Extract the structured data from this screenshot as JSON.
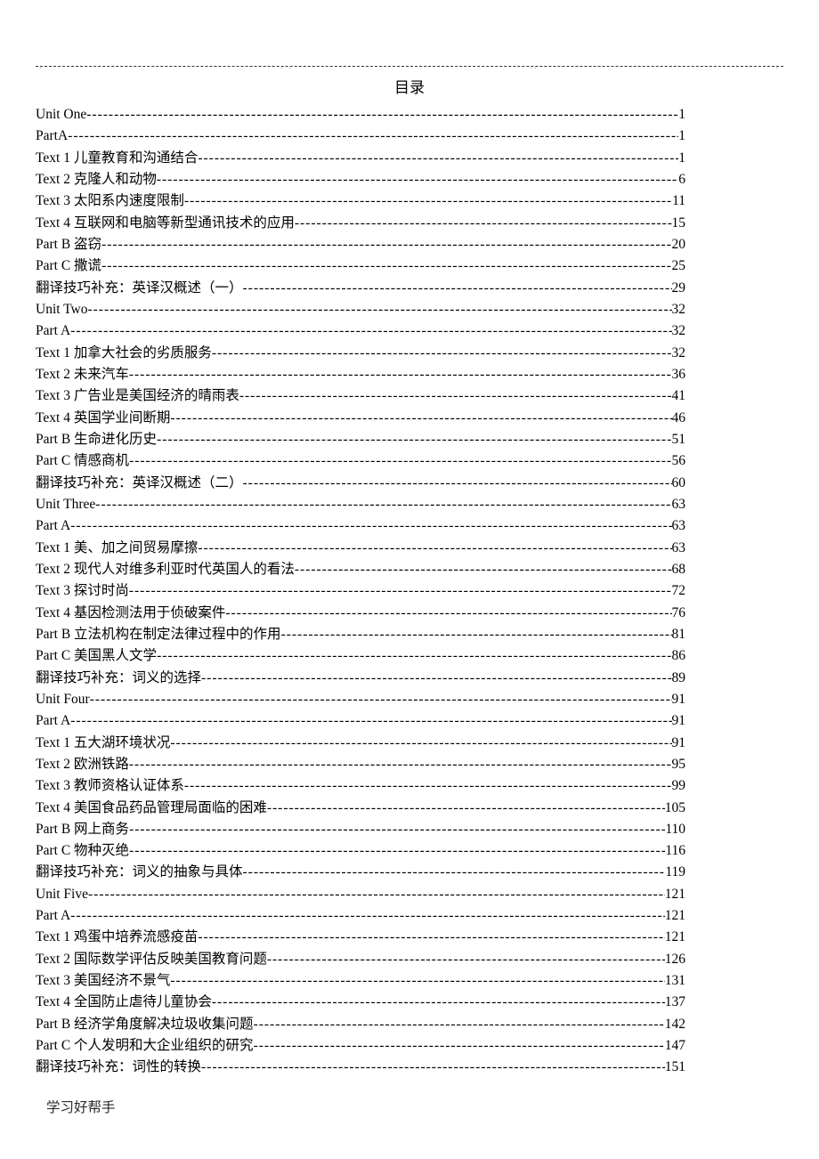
{
  "title": "目录",
  "footer": "学习好帮手",
  "toc": [
    {
      "label": "Unit One",
      "page": "1"
    },
    {
      "label": "PartA ",
      "page": "1"
    },
    {
      "label": "Text 1 儿童教育和沟通结合",
      "page": "1"
    },
    {
      "label": "Text 2 克隆人和动物",
      "page": "6"
    },
    {
      "label": "Text 3 太阳系内速度限制",
      "page": "11"
    },
    {
      "label": "Text 4 互联网和电脑等新型通讯技术的应用",
      "page": "15"
    },
    {
      "label": "Part B 盗窃",
      "page": "20"
    },
    {
      "label": "Part C 撒谎",
      "page": "25"
    },
    {
      "label": "翻译技巧补充：英译汉概述（一）",
      "page": "29"
    },
    {
      "label": "Unit Two",
      "page": "32"
    },
    {
      "label": "Part A",
      "page": "32"
    },
    {
      "label": "Text 1 加拿大社会的劣质服务",
      "page": "32"
    },
    {
      "label": "Text 2 未来汽车",
      "page": "36"
    },
    {
      "label": "Text 3 广告业是美国经济的晴雨表",
      "page": "41"
    },
    {
      "label": "Text 4 英国学业间断期",
      "page": "46"
    },
    {
      "label": "Part B 生命进化历史",
      "page": "51"
    },
    {
      "label": "Part C 情感商机",
      "page": "56"
    },
    {
      "label": "翻译技巧补充：英译汉概述（二）",
      "page": "60"
    },
    {
      "label": "Unit Three",
      "page": "63"
    },
    {
      "label": "Part A",
      "page": "63"
    },
    {
      "label": "Text 1 美、加之间贸易摩擦",
      "page": "63"
    },
    {
      "label": "Text 2 现代人对维多利亚时代英国人的看法",
      "page": "68"
    },
    {
      "label": "Text 3 探讨时尚",
      "page": "72"
    },
    {
      "label": "Text 4 基因检测法用于侦破案件",
      "page": "76"
    },
    {
      "label": "Part B 立法机构在制定法律过程中的作用",
      "page": "81"
    },
    {
      "label": "Part C 美国黑人文学",
      "page": "86"
    },
    {
      "label": "翻译技巧补充：词义的选择",
      "page": "89"
    },
    {
      "label": "Unit Four",
      "page": "91"
    },
    {
      "label": "Part A",
      "page": "91"
    },
    {
      "label": "Text 1 五大湖环境状况",
      "page": "91"
    },
    {
      "label": "Text 2 欧洲铁路",
      "page": "95"
    },
    {
      "label": "Text 3 教师资格认证体系",
      "page": "99"
    },
    {
      "label": "Text 4 美国食品药品管理局面临的困难",
      "page": "105"
    },
    {
      "label": "Part B 网上商务",
      "page": "110"
    },
    {
      "label": "Part C 物种灭绝",
      "page": "116"
    },
    {
      "label": "翻译技巧补充：词义的抽象与具体",
      "page": "119"
    },
    {
      "label": "Unit Five",
      "page": "121"
    },
    {
      "label": "Part A",
      "page": "121"
    },
    {
      "label": "Text 1 鸡蛋中培养流感疫苗",
      "page": "121"
    },
    {
      "label": "Text 2 国际数学评估反映美国教育问题",
      "page": "126"
    },
    {
      "label": "Text 3 美国经济不景气",
      "page": "131"
    },
    {
      "label": "Text 4 全国防止虐待儿童协会",
      "page": "137"
    },
    {
      "label": "Part B 经济学角度解决垃圾收集问题",
      "page": "142"
    },
    {
      "label": "Part C 个人发明和大企业组织的研究",
      "page": "147"
    },
    {
      "label": "翻译技巧补充：词性的转换",
      "page": "151"
    }
  ]
}
